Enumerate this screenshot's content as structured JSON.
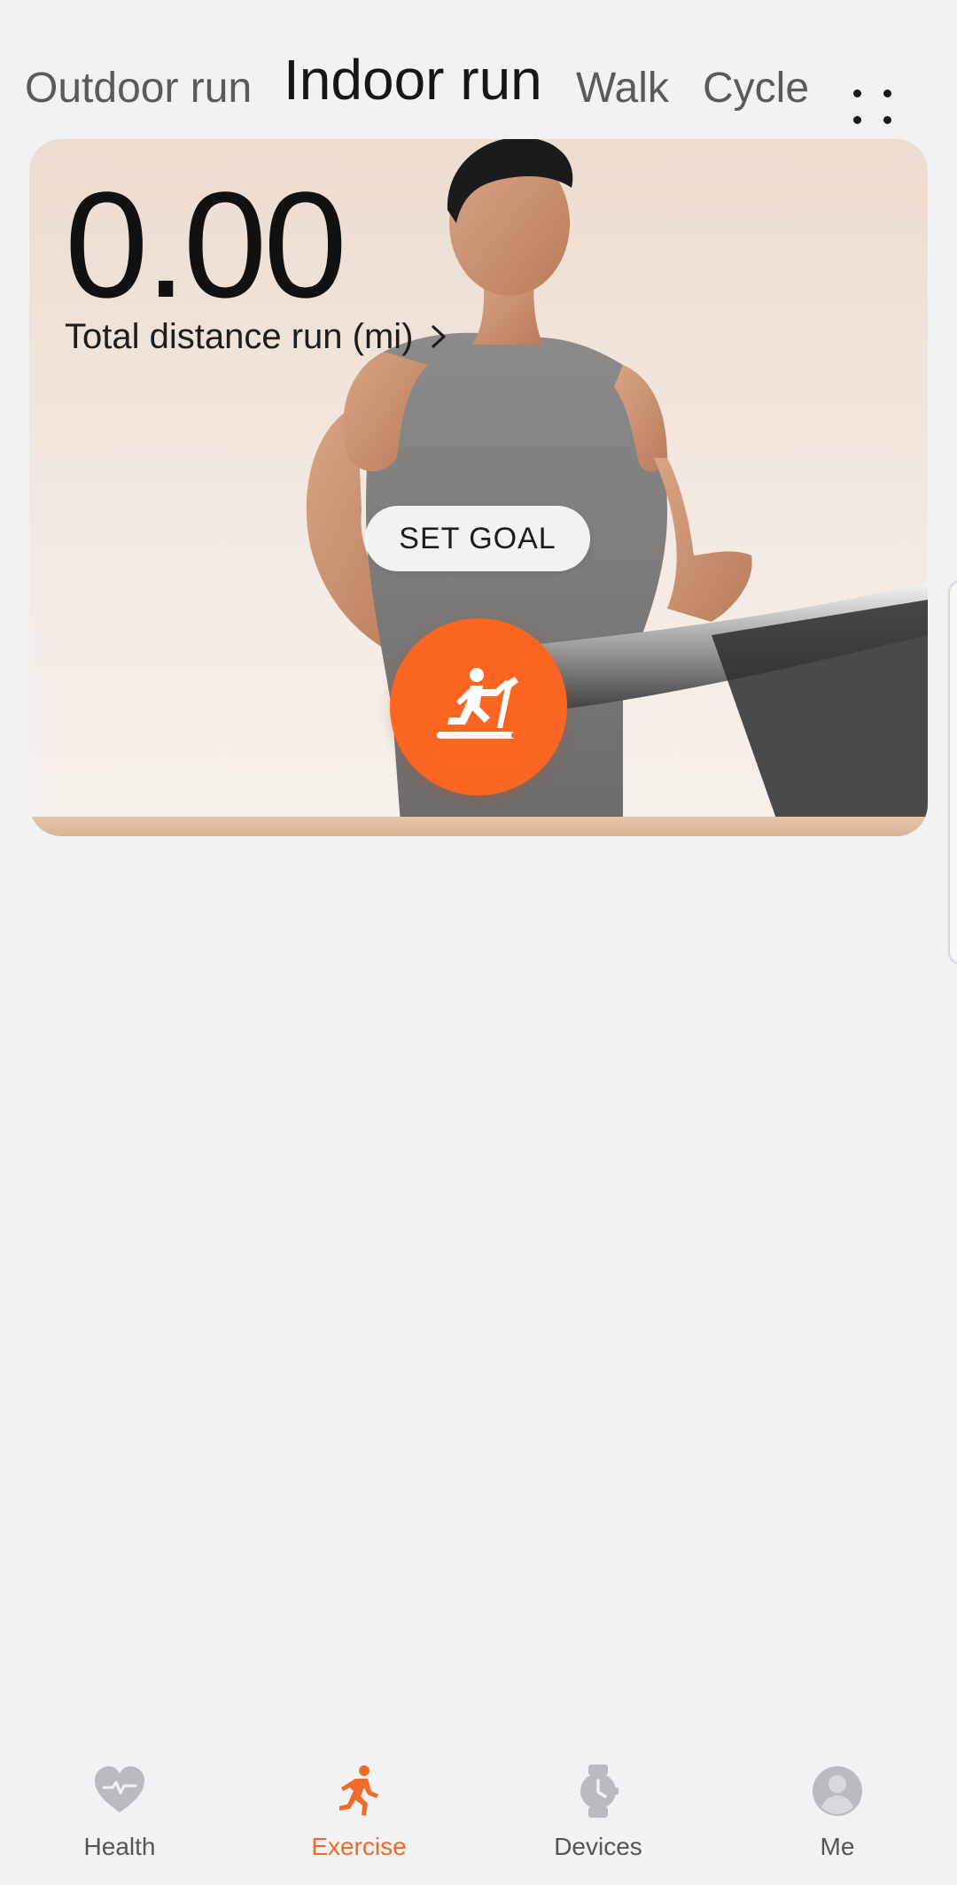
{
  "tabs": [
    {
      "label": "Outdoor run",
      "active": false
    },
    {
      "label": "Indoor run",
      "active": true
    },
    {
      "label": "Walk",
      "active": false
    },
    {
      "label": "Cycle",
      "active": false
    }
  ],
  "more_icon": "four-dots-icon",
  "card": {
    "distance_value": "0.00",
    "distance_label": "Total distance run (mi)",
    "set_goal_label": "SET GOAL",
    "start_icon": "treadmill-runner-icon"
  },
  "bottom_nav": [
    {
      "label": "Health",
      "icon": "heart-pulse-icon",
      "active": false
    },
    {
      "label": "Exercise",
      "icon": "running-person-icon",
      "active": true
    },
    {
      "label": "Devices",
      "icon": "watch-icon",
      "active": false
    },
    {
      "label": "Me",
      "icon": "user-avatar-icon",
      "active": false
    }
  ],
  "colors": {
    "accent": "#fb6522",
    "active_nav": "#f06a2a",
    "background": "#f1f2f4",
    "inactive_icon": "#b9bbbf"
  }
}
